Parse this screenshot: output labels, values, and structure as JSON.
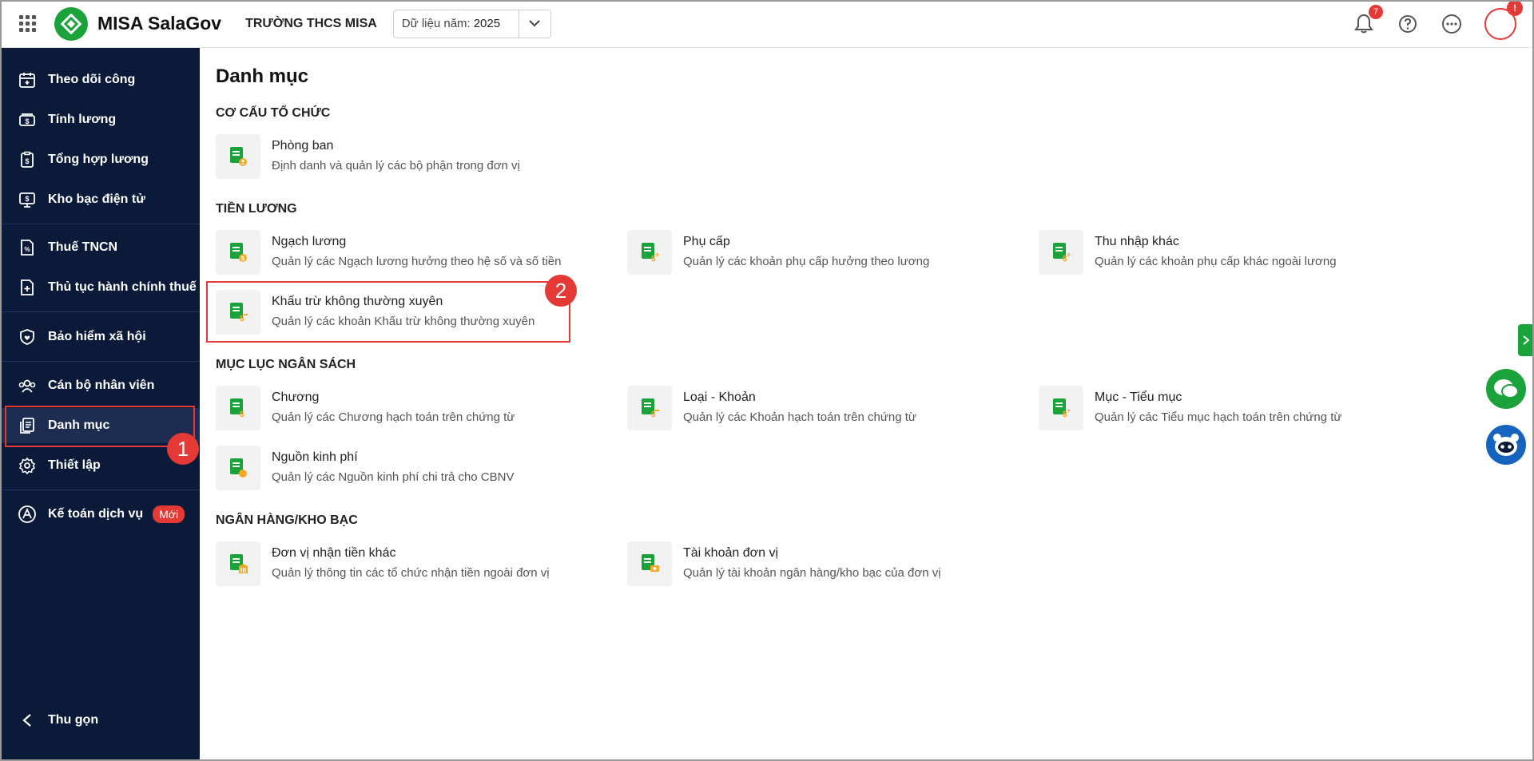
{
  "header": {
    "app_name": "MISA SalaGov",
    "school": "TRƯỜNG THCS MISA",
    "year_label": "Dữ liệu năm:",
    "year_value": "2025",
    "notification_count": "7",
    "avatar_badge": "!"
  },
  "sidebar": {
    "items": [
      {
        "label": "Theo dõi công",
        "icon": "calendar-icon"
      },
      {
        "label": "Tính lương",
        "icon": "money-icon"
      },
      {
        "label": "Tổng hợp lương",
        "icon": "clipboard-dollar-icon"
      },
      {
        "label": "Kho bạc điện tử",
        "icon": "monitor-dollar-icon"
      },
      {
        "label": "Thuế TNCN",
        "icon": "tax-document-icon"
      },
      {
        "label": "Thủ tục hành chính thuế",
        "icon": "document-plus-icon"
      },
      {
        "label": "Bảo hiểm xã hội",
        "icon": "shield-heart-icon"
      },
      {
        "label": "Cán bộ nhân viên",
        "icon": "people-icon"
      },
      {
        "label": "Danh mục",
        "icon": "documents-icon"
      },
      {
        "label": "Thiết lập",
        "icon": "gear-icon"
      },
      {
        "label": "Kế toán dịch vụ",
        "icon": "accounting-icon"
      }
    ],
    "new_badge": "Mới",
    "collapse": "Thu gọn"
  },
  "steps": {
    "one": "1",
    "two": "2"
  },
  "main": {
    "title": "Danh mục",
    "sections": [
      {
        "title": "CƠ CẤU TỔ CHỨC"
      },
      {
        "title": "TIỀN LƯƠNG"
      },
      {
        "title": "MỤC LỤC NGÂN SÁCH"
      },
      {
        "title": "NGÂN HÀNG/KHO BẠC"
      }
    ],
    "cards": {
      "phong_ban": {
        "title": "Phòng ban",
        "desc": "Định danh và quản lý các bộ phận trong đơn vị"
      },
      "ngach_luong": {
        "title": "Ngạch lương",
        "desc": "Quản lý các Ngạch lương hưởng theo hệ số và số tiền"
      },
      "phu_cap": {
        "title": "Phụ cấp",
        "desc": "Quản lý các khoản phụ cấp hưởng theo lương"
      },
      "thu_nhap_khac": {
        "title": "Thu nhập khác",
        "desc": "Quản lý các khoản phụ cấp khác ngoài lương"
      },
      "khau_tru": {
        "title": "Khấu trừ không thường xuyên",
        "desc": "Quản lý các khoản Khấu trừ không thường xuyên"
      },
      "chuong": {
        "title": "Chương",
        "desc": "Quản lý các Chương hạch toán trên chứng từ"
      },
      "loai_khoan": {
        "title": "Loại - Khoản",
        "desc": "Quản lý các Khoản hạch toán trên chứng từ"
      },
      "muc_tieu_muc": {
        "title": "Mục - Tiểu mục",
        "desc": "Quản lý các Tiểu mục hạch toán trên chứng từ"
      },
      "nguon_kinh_phi": {
        "title": "Nguồn kinh phí",
        "desc": "Quản lý các Nguồn kinh phí chi trả cho CBNV"
      },
      "don_vi_nhan_tien": {
        "title": "Đơn vị nhận tiền khác",
        "desc": "Quản lý thông tin các tổ chức nhận tiền ngoài đơn vị"
      },
      "tai_khoan_don_vi": {
        "title": "Tài khoản đơn vị",
        "desc": "Quản lý tài khoản ngân hàng/kho bạc của đơn vị"
      }
    }
  },
  "colors": {
    "accent": "#1aa33a",
    "sidebar_bg": "#0c1a3a",
    "highlight": "#e53935",
    "icon_orange": "#f5a623"
  }
}
